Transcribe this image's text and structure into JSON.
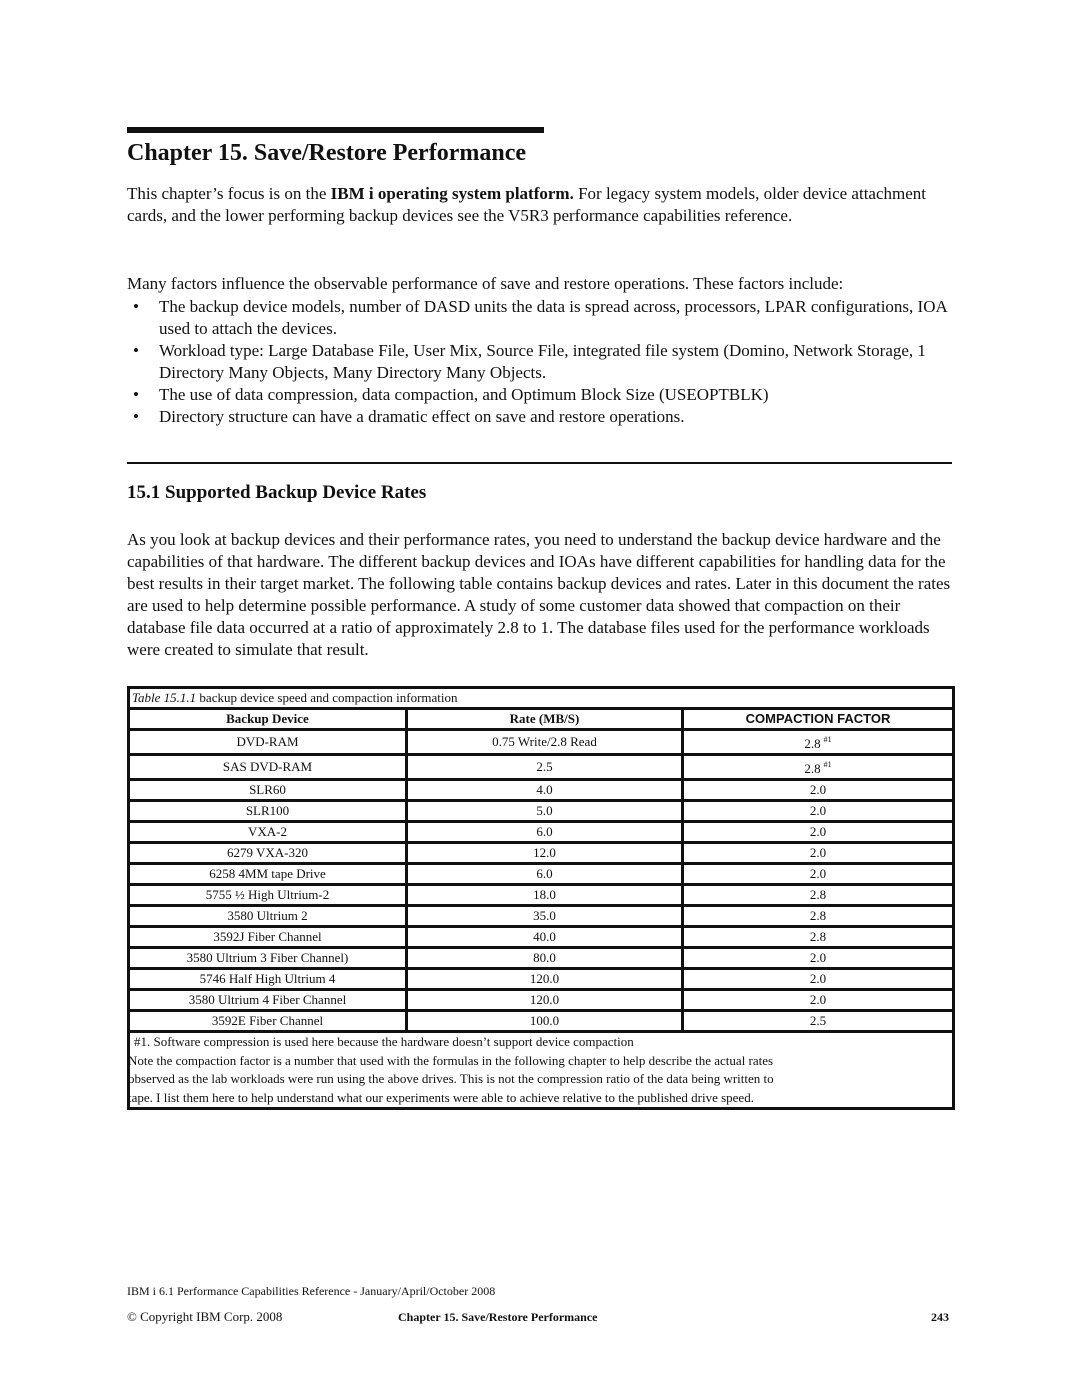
{
  "chapter": {
    "title": "Chapter 15.  Save/Restore Performance"
  },
  "intro": {
    "lead": "This chapter’s focus is on the ",
    "bold": "IBM i operating system platform.",
    "rest": "  For legacy system models, older device attachment cards, and the lower performing backup devices see the V5R3 performance capabilities reference."
  },
  "factors": {
    "lead": "Many factors influence the observable performance of save and restore operations. These factors include:",
    "bullet_glyph": "•",
    "items": [
      "The backup device models,  number of DASD units the data is spread across, processors, LPAR configurations, IOA used to attach the devices.",
      "Workload type: Large Database File, User Mix, Source File, integrated file system (Domino, Network Storage, 1 Directory Many Objects, Many Directory Many Objects.",
      "The use of data compression, data compaction, and Optimum Block Size (USEOPTBLK)",
      "Directory structure can have a dramatic effect on save and restore operations."
    ]
  },
  "section": {
    "title": "15.1  Supported Backup Device Rates",
    "paragraph": "As you look at backup devices and their performance rates, you need to understand the backup device hardware and the capabilities of that hardware. The different backup devices and IOAs have different capabilities for handling data for the best results in their target market. The following table contains backup devices and rates.  Later in this document the rates are used to help determine possible performance.  A study of  some customer data showed that compaction on their database file data occurred at a ratio of approximately 2.8 to 1. The database files used for the performance  workloads were created to simulate that result."
  },
  "table": {
    "caption_label": "Table 15.1.1",
    "caption_text": "  backup device speed and compaction information",
    "headers": [
      "Backup Device",
      "Rate (MB/S)",
      "COMPACTION FACTOR"
    ],
    "rows": [
      {
        "device": "DVD-RAM",
        "rate": "0.75 Write/2.8 Read",
        "factor": "2.8",
        "note": "#1"
      },
      {
        "device": "SAS DVD-RAM",
        "rate": "2.5",
        "factor": "2.8",
        "note": "#1"
      },
      {
        "device": "SLR60",
        "rate": "4.0",
        "factor": "2.0",
        "note": ""
      },
      {
        "device": "SLR100",
        "rate": "5.0",
        "factor": "2.0",
        "note": ""
      },
      {
        "device": "VXA-2",
        "rate": "6.0",
        "factor": "2.0",
        "note": ""
      },
      {
        "device": "6279 VXA-320",
        "rate": "12.0",
        "factor": "2.0",
        "note": ""
      },
      {
        "device": "6258 4MM tape Drive",
        "rate": "6.0",
        "factor": "2.0",
        "note": ""
      },
      {
        "device": "5755  ½ High Ultrium-2",
        "rate": "18.0",
        "factor": "2.8",
        "note": ""
      },
      {
        "device": "3580 Ultrium 2",
        "rate": "35.0",
        "factor": "2.8",
        "note": ""
      },
      {
        "device": "3592J Fiber Channel",
        "rate": "40.0",
        "factor": "2.8",
        "note": ""
      },
      {
        "device": "3580 Ultrium 3 Fiber Channel)",
        "rate": "80.0",
        "factor": "2.0",
        "note": ""
      },
      {
        "device": "5746 Half High Ultrium 4",
        "rate": "120.0",
        "factor": "2.0",
        "note": ""
      },
      {
        "device": "3580 Ultrium 4 Fiber Channel",
        "rate": "120.0",
        "factor": "2.0",
        "note": ""
      },
      {
        "device": "3592E Fiber Channel",
        "rate": "100.0",
        "factor": "2.5",
        "note": ""
      }
    ],
    "notes": [
      "#1. Software compression is used here because the hardware doesn’t support device compaction",
      "Note the compaction factor is a number that used with the formulas in the following chapter to help describe the actual rates",
      "observed as the lab workloads were run using the above drives.  This is not the compression ratio of the data being written to",
      "tape. I list them here to help understand what our experiments were able to achieve relative to the published drive speed."
    ]
  },
  "footer": {
    "doc_title": "IBM i 6.1 Performance Capabilities Reference - January/April/October 2008",
    "copyright_symbol": "©",
    "copyright_text": " Copyright IBM Corp. 2008",
    "chapter": "Chapter 15.  Save/Restore Performance",
    "page_number": "243"
  }
}
